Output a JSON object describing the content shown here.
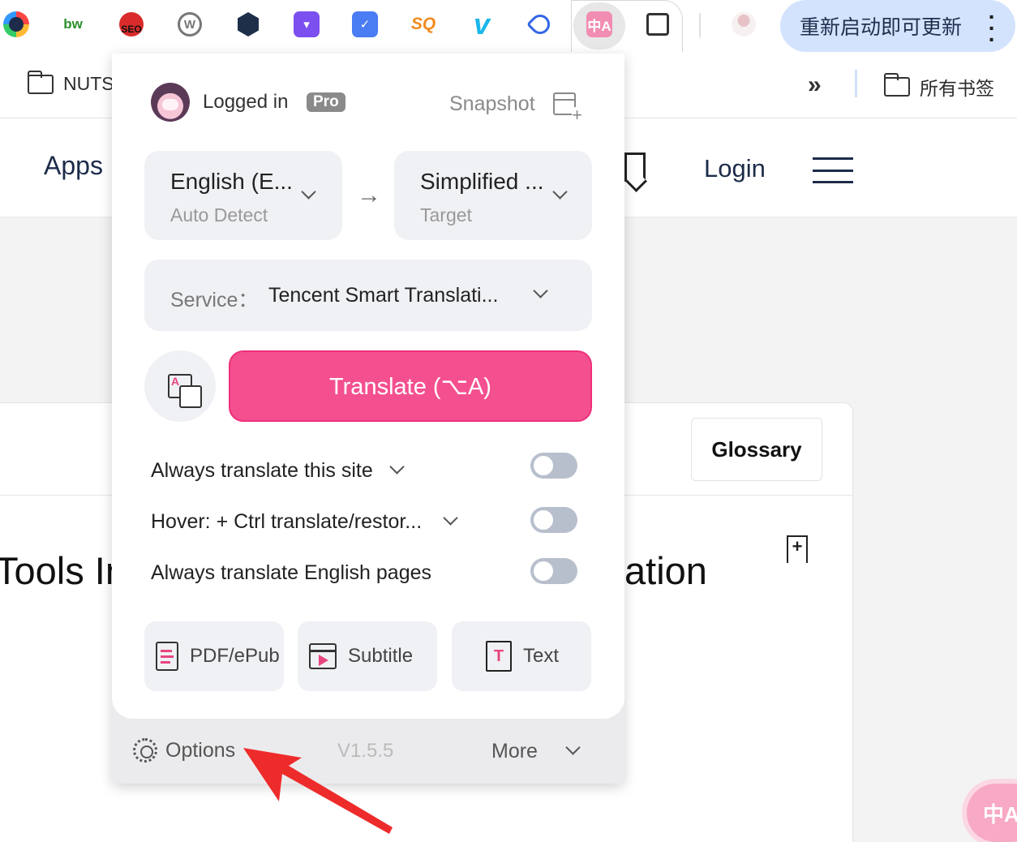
{
  "toolbar": {
    "extensions": [
      {
        "icon": "circle-logo-icon",
        "label": "",
        "color": "#5b7ce8"
      },
      {
        "icon": "bw-icon",
        "label": "bw",
        "color": "#2d8f2d"
      },
      {
        "icon": "seo-icon",
        "label": "SEO",
        "color": "#d92b2b"
      },
      {
        "icon": "wordpress-icon",
        "label": "W",
        "color": "#666666"
      },
      {
        "icon": "cube-icon",
        "label": "",
        "color": "#1e2f4a"
      },
      {
        "icon": "purple-t-icon",
        "label": "",
        "color": "#7b4ff0"
      },
      {
        "icon": "checklist-icon",
        "label": "",
        "color": "#4a7cf3"
      },
      {
        "icon": "sq-icon",
        "label": "SQ",
        "color": "#f18a1f"
      },
      {
        "icon": "vimeo-icon",
        "label": "v",
        "color": "#1ab7ea"
      },
      {
        "icon": "tag-icon",
        "label": "",
        "color": "#3366e6"
      },
      {
        "icon": "translate-ext-icon",
        "label": "",
        "color": "#e8457f"
      },
      {
        "icon": "puzzle-icon",
        "label": "",
        "color": "#333333"
      },
      {
        "icon": "profile-icon",
        "label": "",
        "color": "#d6a8b0"
      }
    ],
    "update_button": "重新启动即可更新"
  },
  "bookmarks": {
    "folder_left": "NUTS",
    "folder_right": "所有书签"
  },
  "page": {
    "nav_apps": "Apps",
    "nav_login": "Login",
    "glossary": "Glossary",
    "heading_left": "Tools In",
    "heading_right": "ation"
  },
  "popup": {
    "logged_in": "Logged in",
    "pro": "Pro",
    "snapshot": "Snapshot",
    "source_lang": {
      "name": "English (E...",
      "sub": "Auto Detect"
    },
    "target_lang": {
      "name": "Simplified ...",
      "sub": "Target"
    },
    "service_label": "Service：",
    "service_value": "Tencent Smart Translati...",
    "translate_button": "Translate (⌥A)",
    "toggles": [
      {
        "label": "Always translate this site",
        "on": false
      },
      {
        "label": "Hover:  + Ctrl translate/restor...",
        "on": false
      },
      {
        "label": "Always translate English pages",
        "on": false
      }
    ],
    "tools": [
      {
        "label": "PDF/ePub"
      },
      {
        "label": "Subtitle"
      },
      {
        "label": "Text"
      }
    ],
    "footer": {
      "options": "Options",
      "version": "V1.5.5",
      "more": "More"
    },
    "accent_color": "#f4508f"
  }
}
